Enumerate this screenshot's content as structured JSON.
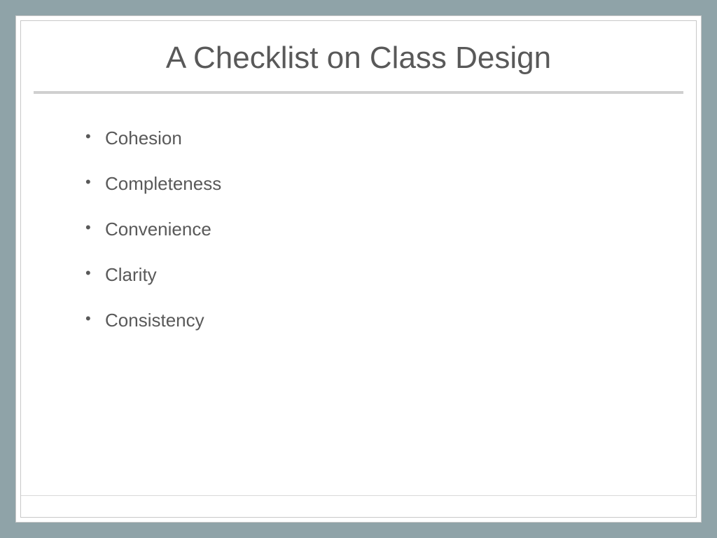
{
  "slide": {
    "title": "A Checklist on Class Design",
    "bullets": [
      "Cohesion",
      "Completeness",
      "Convenience",
      "Clarity",
      "Consistency"
    ]
  }
}
